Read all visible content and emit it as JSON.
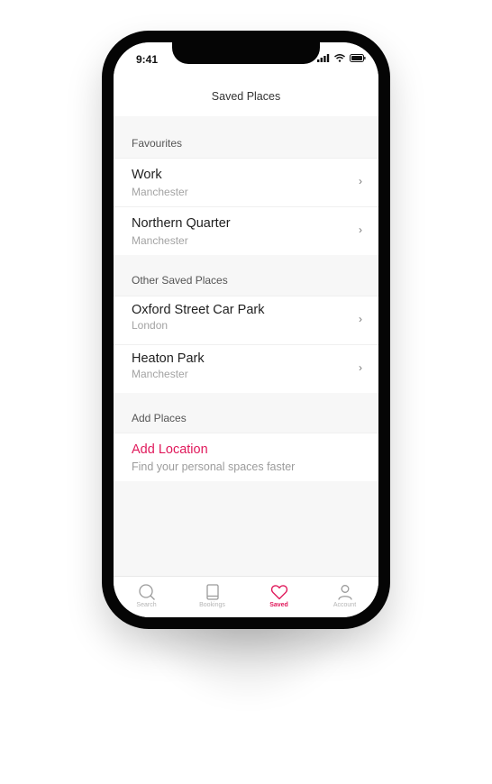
{
  "status_bar": {
    "time": "9:41"
  },
  "header": {
    "title": "Saved Places"
  },
  "sections": {
    "favourites": {
      "label": "Favourites",
      "items": [
        {
          "title": "Work",
          "subtitle": "Manchester"
        },
        {
          "title": "Northern Quarter",
          "subtitle": "Manchester"
        }
      ]
    },
    "other": {
      "label": "Other Saved Places",
      "items": [
        {
          "title": "Oxford Street Car Park",
          "subtitle": "London"
        },
        {
          "title": "Heaton Park",
          "subtitle": "Manchester"
        }
      ]
    },
    "add": {
      "label": "Add Places",
      "title": "Add Location",
      "subtitle": "Find your personal spaces faster"
    }
  },
  "chevron": "›",
  "tabbar": {
    "tabs": [
      {
        "label": "Search",
        "icon": "search-icon"
      },
      {
        "label": "Bookings",
        "icon": "book-icon"
      },
      {
        "label": "Saved",
        "icon": "heart-icon"
      },
      {
        "label": "Account",
        "icon": "user-icon"
      }
    ],
    "active_index": 2
  },
  "colors": {
    "accent": "#e0195b",
    "background": "#f7f7f7",
    "surface": "#ffffff"
  }
}
